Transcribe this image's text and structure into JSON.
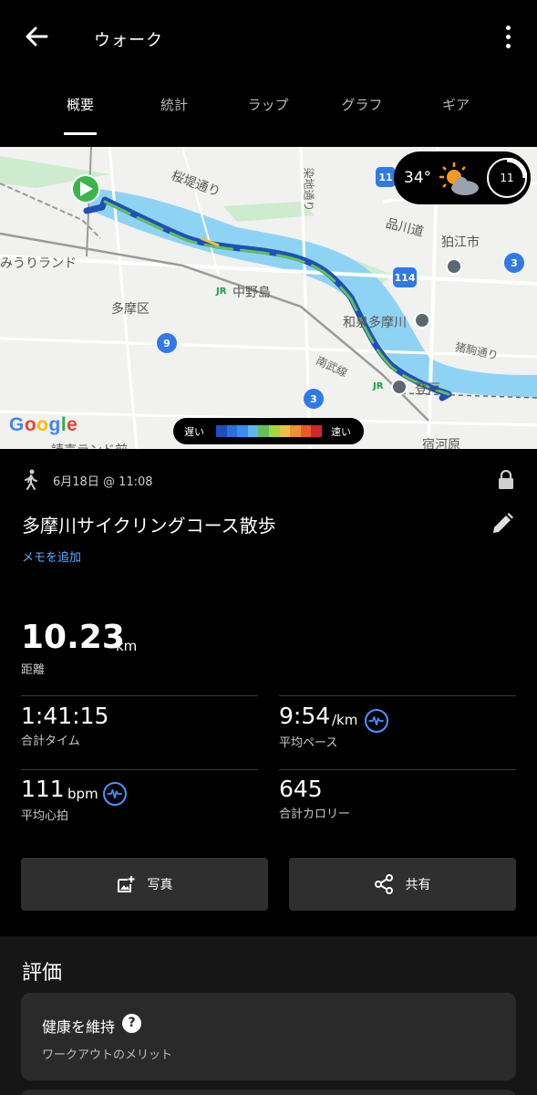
{
  "header": {
    "title": "ウォーク",
    "back_icon": "arrow-back-icon",
    "menu_icon": "more-vertical-icon"
  },
  "tabs": [
    {
      "label": "概要",
      "active": true
    },
    {
      "label": "統計",
      "active": false
    },
    {
      "label": "ラップ",
      "active": false
    },
    {
      "label": "グラフ",
      "active": false
    },
    {
      "label": "ギア",
      "active": false
    }
  ],
  "map": {
    "labels": {
      "sakura": "桜堤通り",
      "shikaku": "狛江市",
      "kanagawa": "品川道",
      "tamaku": "多摩区",
      "nakanoshima": "中野島",
      "miuraland": "みうりランド",
      "izumi": "和泉多摩川",
      "nanbu": "南武線",
      "noborito": "登戸",
      "inokoma": "猪駒通り",
      "shukugawara": "宿河原",
      "yomiuri": "読売ランド前",
      "baseball": "染地通り"
    },
    "route_numbers": [
      "11",
      "114",
      "9",
      "3",
      "3"
    ],
    "weather": {
      "temperature": "34°",
      "icon": "partly-cloudy-sun-icon",
      "uv_value": "11"
    },
    "provider": "Google",
    "speed_legend": {
      "slow_label": "遅い",
      "fast_label": "速い",
      "colors": [
        "#1f4fb8",
        "#2f6ee0",
        "#3c8df0",
        "#62b5f0",
        "#62c05a",
        "#a8d43c",
        "#f0c040",
        "#f09030",
        "#e85a2a",
        "#d02828"
      ]
    }
  },
  "activity": {
    "type_icon": "walk-icon",
    "date": "6月18日 @ 11:08",
    "privacy_icon": "lock-icon",
    "name": "多摩川サイクリングコース散歩",
    "edit_icon": "pencil-icon",
    "add_memo": "メモを追加"
  },
  "metrics": {
    "distance": {
      "value": "10.23",
      "unit": "km",
      "label": "距離"
    },
    "total_time": {
      "value": "1:41:15",
      "label": "合計タイム"
    },
    "avg_pace": {
      "value": "9:54",
      "unit": "/km",
      "label": "平均ペース"
    },
    "avg_hr": {
      "value": "111",
      "unit": "bpm",
      "label": "平均心拍"
    },
    "calories": {
      "value": "645",
      "label": "合計カロリー"
    }
  },
  "actions": {
    "photo": {
      "label": "写真",
      "icon": "add-photo-icon"
    },
    "share": {
      "label": "共有",
      "icon": "share-icon"
    }
  },
  "rating": {
    "title": "評価",
    "card_title": "健康を維持",
    "card_help": "?",
    "card_subtitle": "ワークアウトのメリット"
  },
  "colors": {
    "accent_blue": "#4d93ff",
    "link_blue": "#5aa9ff",
    "river": "#8fd3f4",
    "start_marker": "#3bb54a"
  }
}
